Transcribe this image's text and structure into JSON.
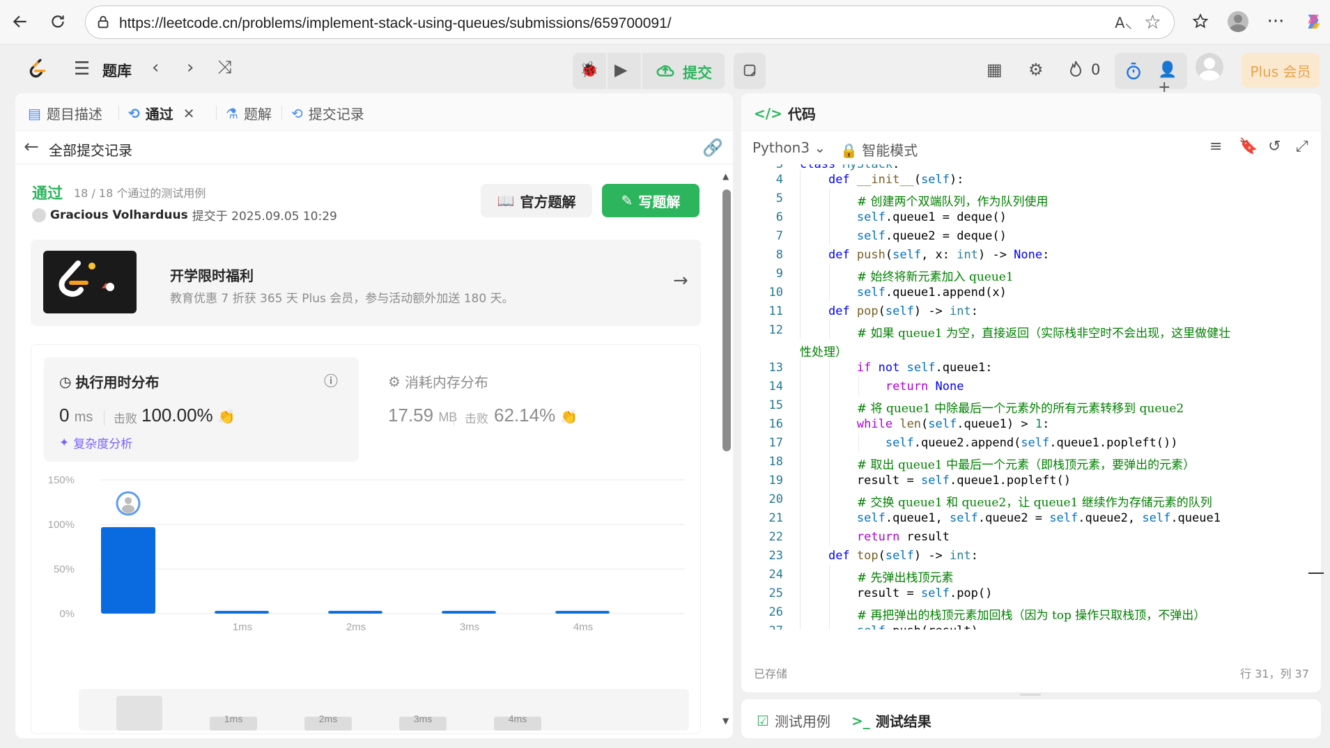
{
  "browser": {
    "url": "https://leetcode.cn/problems/implement-stack-using-queues/submissions/659700091/",
    "read_aloud": "Aͅ",
    "icons": [
      "back-icon",
      "refresh-icon",
      "lock-icon",
      "read-aloud-icon",
      "favorite-star-icon",
      "collections-icon",
      "profile-icon",
      "more-icon",
      "copilot-icon"
    ]
  },
  "nav": {
    "title": "题库",
    "submit_label": "提交",
    "fire_count": "0",
    "plus_label": "Plus 会员"
  },
  "tabs": [
    {
      "label": "题目描述"
    },
    {
      "label": "通过"
    },
    {
      "label": "题解"
    },
    {
      "label": "提交记录"
    }
  ],
  "back_label": "全部提交记录",
  "submission": {
    "status": "通过",
    "count": "18 / 18 个通过的测试用例",
    "author": "Gracious Volharduus",
    "submitted": "提交于 2025.09.05 10:29",
    "official_btn": "官方题解",
    "write_btn": "写题解"
  },
  "promo": {
    "title": "开学限时福利",
    "desc": "教育优惠 7 折获 365 天 Plus 会员，参与活动额外加送 180 天。"
  },
  "runtime": {
    "title": "执行用时分布",
    "value": "0",
    "unit": "ms",
    "beat_label": "击败",
    "pct": "100.00%",
    "complexity": "复杂度分析"
  },
  "memory": {
    "title": "消耗内存分布",
    "value": "17.59",
    "unit": "MB",
    "beat_label": "击败",
    "pct": "62.14%"
  },
  "chart_data": {
    "type": "bar",
    "categories": [
      "",
      "1ms",
      "2ms",
      "3ms",
      "4ms"
    ],
    "values": [
      97,
      3,
      3,
      3,
      3
    ],
    "y_ticks": [
      "150%",
      "100%",
      "50%",
      "0%"
    ],
    "ylim": [
      0,
      150
    ],
    "bar_color": "#0a6be0",
    "highlight_index": 0
  },
  "mini_ticks": [
    "1ms",
    "2ms",
    "3ms",
    "4ms"
  ],
  "editor": {
    "title": "代码",
    "language": "Python3",
    "mode": "智能模式",
    "saved": "已存储",
    "position": "行 31，列 37"
  },
  "bottom_tabs": {
    "testcase": "测试用例",
    "result": "测试结果"
  }
}
